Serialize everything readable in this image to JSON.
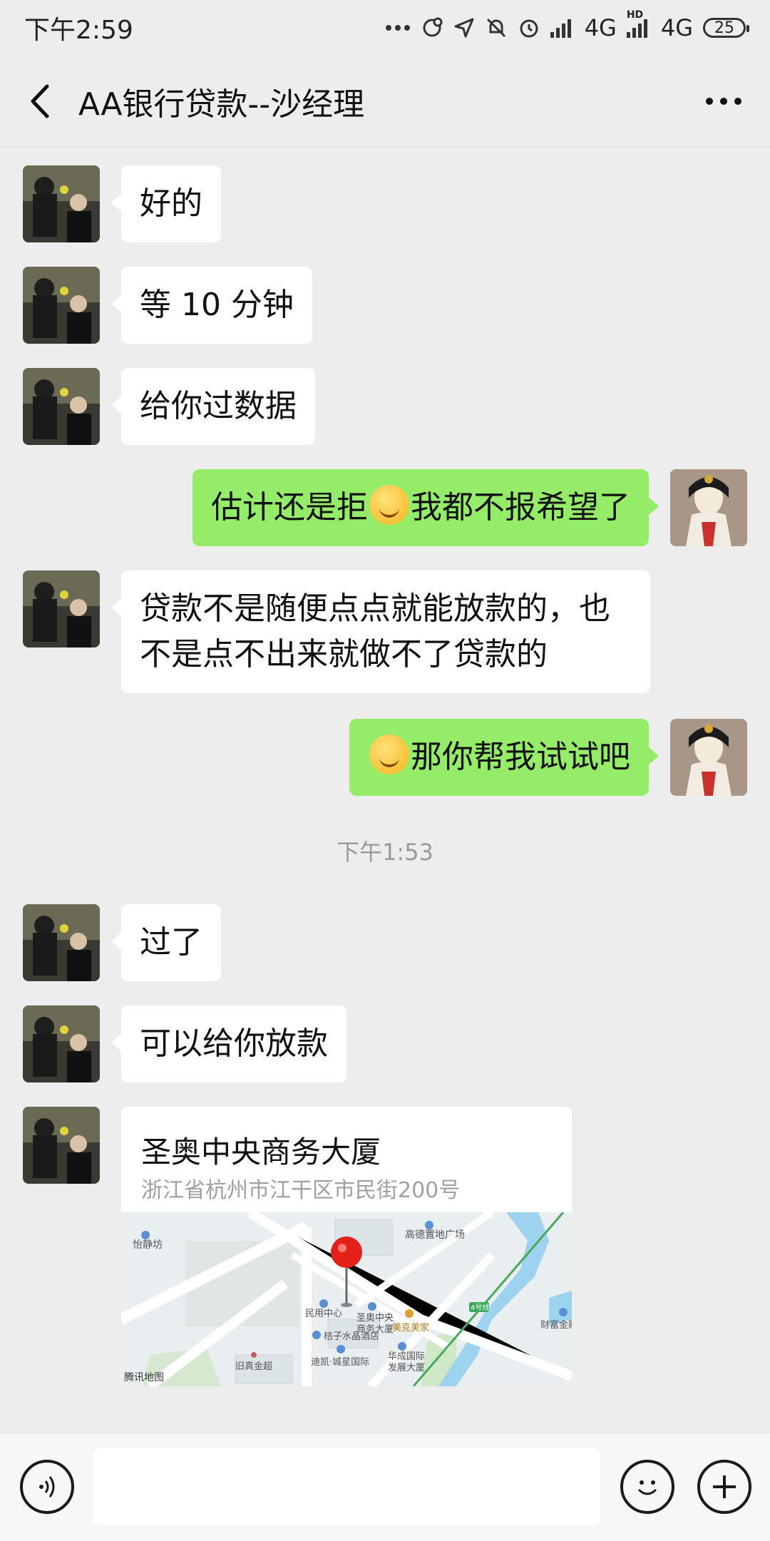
{
  "status_bar": {
    "time": "下午2:59",
    "network1": "4G",
    "network2": "4G",
    "hd_label": "HD",
    "battery": "25",
    "icons": [
      "more-dots-icon",
      "link-icon",
      "location-arrow-icon",
      "bell-off-icon",
      "alarm-icon",
      "signal-icon",
      "signal-icon",
      "battery-icon"
    ]
  },
  "header": {
    "title": "AA银行贷款--沙经理"
  },
  "messages": [
    {
      "side": "in",
      "text": "好的"
    },
    {
      "side": "in",
      "text": "等 10 分钟"
    },
    {
      "side": "in",
      "text": "给你过数据"
    },
    {
      "side": "out",
      "text_before": "估计还是拒",
      "emoji": "laughing-crying-emoji",
      "text_after": "我都不报希望了"
    },
    {
      "side": "in",
      "text": "贷款不是随便点点就能放款的，也不是点不出来就做不了贷款的"
    },
    {
      "side": "out",
      "emoji": "smirk-emoji",
      "text_after": "那你帮我试试吧"
    },
    {
      "side": "in",
      "text": "过了"
    },
    {
      "side": "in",
      "text": "可以给你放款"
    }
  ],
  "timestamp": "下午1:53",
  "location": {
    "name": "圣奥中央商务大厦",
    "address": "浙江省杭州市江干区市民街200号",
    "map_labels": {
      "a": "怡静坊",
      "b": "高德置地广场",
      "c": "民用中心",
      "d": "圣奥中央",
      "e": "商务大厦",
      "f": "美克美家",
      "g": "桔子水晶酒店",
      "h": "迪凯·城星国际",
      "i": "华成国际",
      "j": "发展大厦",
      "k": "旧真金超",
      "l": "财富金融",
      "m": "4号线",
      "provider": "腾讯地图"
    }
  },
  "input": {
    "placeholder": ""
  }
}
